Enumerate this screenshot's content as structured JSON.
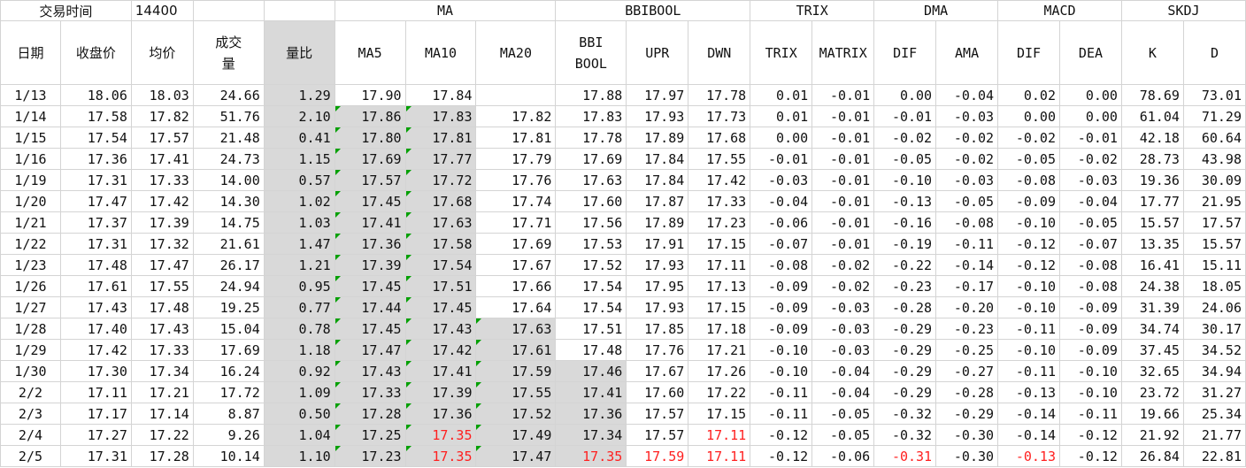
{
  "header_top": {
    "trade_time_label": "交易时间",
    "trade_time_value": "14400",
    "groups": [
      "MA",
      "BBIBOOL",
      "TRIX",
      "DMA",
      "MACD",
      "SKDJ"
    ]
  },
  "columns": [
    "日期",
    "收盘价",
    "均价",
    "成交量",
    "量比",
    "MA5",
    "MA10",
    "MA20",
    "BBI BOOL",
    "UPR",
    "DWN",
    "TRIX",
    "MATRIX",
    "DIF",
    "AMA",
    "DIF",
    "DEA",
    "K",
    "D"
  ],
  "colors": {
    "grey_cell": "#d9d9d9",
    "red_value": "#ff1f1f",
    "flag_green": "#00a000"
  },
  "rows": [
    [
      "1/13",
      "18.06",
      "18.03",
      "24.66",
      "1.29",
      "17.90",
      "17.84",
      "",
      "17.88",
      "17.97",
      "17.78",
      "0.01",
      "-0.01",
      "0.00",
      "-0.04",
      "0.02",
      "0.00",
      "78.69",
      "73.01"
    ],
    [
      "1/14",
      "17.58",
      "17.82",
      "51.76",
      "2.10",
      "17.86",
      "17.83",
      "17.82",
      "17.83",
      "17.93",
      "17.73",
      "0.01",
      "-0.01",
      "-0.01",
      "-0.03",
      "0.00",
      "0.00",
      "61.04",
      "71.29"
    ],
    [
      "1/15",
      "17.54",
      "17.57",
      "21.48",
      "0.41",
      "17.80",
      "17.81",
      "17.81",
      "17.78",
      "17.89",
      "17.68",
      "0.00",
      "-0.01",
      "-0.02",
      "-0.02",
      "-0.02",
      "-0.01",
      "42.18",
      "60.64"
    ],
    [
      "1/16",
      "17.36",
      "17.41",
      "24.73",
      "1.15",
      "17.69",
      "17.77",
      "17.79",
      "17.69",
      "17.84",
      "17.55",
      "-0.01",
      "-0.01",
      "-0.05",
      "-0.02",
      "-0.05",
      "-0.02",
      "28.73",
      "43.98"
    ],
    [
      "1/19",
      "17.31",
      "17.33",
      "14.00",
      "0.57",
      "17.57",
      "17.72",
      "17.76",
      "17.63",
      "17.84",
      "17.42",
      "-0.03",
      "-0.01",
      "-0.10",
      "-0.03",
      "-0.08",
      "-0.03",
      "19.36",
      "30.09"
    ],
    [
      "1/20",
      "17.47",
      "17.42",
      "14.30",
      "1.02",
      "17.45",
      "17.68",
      "17.74",
      "17.60",
      "17.87",
      "17.33",
      "-0.04",
      "-0.01",
      "-0.13",
      "-0.05",
      "-0.09",
      "-0.04",
      "17.77",
      "21.95"
    ],
    [
      "1/21",
      "17.37",
      "17.39",
      "14.75",
      "1.03",
      "17.41",
      "17.63",
      "17.71",
      "17.56",
      "17.89",
      "17.23",
      "-0.06",
      "-0.01",
      "-0.16",
      "-0.08",
      "-0.10",
      "-0.05",
      "15.57",
      "17.57"
    ],
    [
      "1/22",
      "17.31",
      "17.32",
      "21.61",
      "1.47",
      "17.36",
      "17.58",
      "17.69",
      "17.53",
      "17.91",
      "17.15",
      "-0.07",
      "-0.01",
      "-0.19",
      "-0.11",
      "-0.12",
      "-0.07",
      "13.35",
      "15.57"
    ],
    [
      "1/23",
      "17.48",
      "17.47",
      "26.17",
      "1.21",
      "17.39",
      "17.54",
      "17.67",
      "17.52",
      "17.93",
      "17.11",
      "-0.08",
      "-0.02",
      "-0.22",
      "-0.14",
      "-0.12",
      "-0.08",
      "16.41",
      "15.11"
    ],
    [
      "1/26",
      "17.61",
      "17.55",
      "24.94",
      "0.95",
      "17.45",
      "17.51",
      "17.66",
      "17.54",
      "17.95",
      "17.13",
      "-0.09",
      "-0.02",
      "-0.23",
      "-0.17",
      "-0.10",
      "-0.08",
      "24.38",
      "18.05"
    ],
    [
      "1/27",
      "17.43",
      "17.48",
      "19.25",
      "0.77",
      "17.44",
      "17.45",
      "17.64",
      "17.54",
      "17.93",
      "17.15",
      "-0.09",
      "-0.03",
      "-0.28",
      "-0.20",
      "-0.10",
      "-0.09",
      "31.39",
      "24.06"
    ],
    [
      "1/28",
      "17.40",
      "17.43",
      "15.04",
      "0.78",
      "17.45",
      "17.43",
      "17.63",
      "17.51",
      "17.85",
      "17.18",
      "-0.09",
      "-0.03",
      "-0.29",
      "-0.23",
      "-0.11",
      "-0.09",
      "34.74",
      "30.17"
    ],
    [
      "1/29",
      "17.42",
      "17.33",
      "17.69",
      "1.18",
      "17.47",
      "17.42",
      "17.61",
      "17.48",
      "17.76",
      "17.21",
      "-0.10",
      "-0.03",
      "-0.29",
      "-0.25",
      "-0.10",
      "-0.09",
      "37.45",
      "34.52"
    ],
    [
      "1/30",
      "17.30",
      "17.34",
      "16.24",
      "0.92",
      "17.43",
      "17.41",
      "17.59",
      "17.46",
      "17.67",
      "17.26",
      "-0.10",
      "-0.04",
      "-0.29",
      "-0.27",
      "-0.11",
      "-0.10",
      "32.65",
      "34.94"
    ],
    [
      "2/2",
      "17.11",
      "17.21",
      "17.72",
      "1.09",
      "17.33",
      "17.39",
      "17.55",
      "17.41",
      "17.60",
      "17.22",
      "-0.11",
      "-0.04",
      "-0.29",
      "-0.28",
      "-0.13",
      "-0.10",
      "23.72",
      "31.27"
    ],
    [
      "2/3",
      "17.17",
      "17.14",
      "8.87",
      "0.50",
      "17.28",
      "17.36",
      "17.52",
      "17.36",
      "17.57",
      "17.15",
      "-0.11",
      "-0.05",
      "-0.32",
      "-0.29",
      "-0.14",
      "-0.11",
      "19.66",
      "25.34"
    ],
    [
      "2/4",
      "17.27",
      "17.22",
      "9.26",
      "1.04",
      "17.25",
      "17.35",
      "17.49",
      "17.34",
      "17.57",
      "17.11",
      "-0.12",
      "-0.05",
      "-0.32",
      "-0.30",
      "-0.14",
      "-0.12",
      "21.92",
      "21.77"
    ],
    [
      "2/5",
      "17.31",
      "17.28",
      "10.14",
      "1.10",
      "17.23",
      "17.35",
      "17.47",
      "17.35",
      "17.59",
      "17.11",
      "-0.12",
      "-0.06",
      "-0.31",
      "-0.30",
      "-0.13",
      "-0.12",
      "26.84",
      "22.81"
    ]
  ]
}
